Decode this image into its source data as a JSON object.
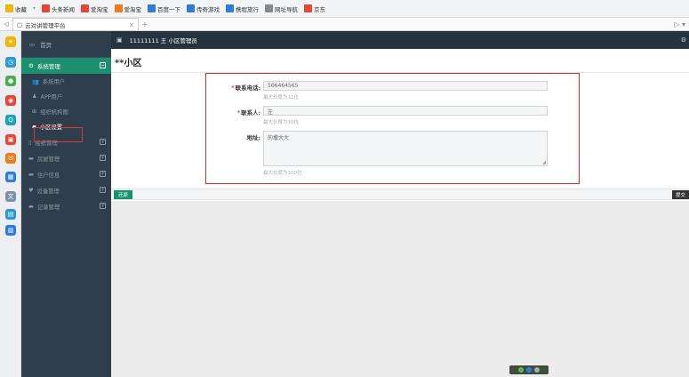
{
  "browser": {
    "bookmarks": [
      {
        "label": "收藏",
        "color": "#f5b400",
        "icon": "star-icon"
      },
      {
        "label": "头条新闻",
        "color": "#e8443a",
        "icon": "news-icon"
      },
      {
        "label": "爱淘宝",
        "color": "#e8443a",
        "icon": "taobao-icon"
      },
      {
        "label": "爱淘宝",
        "color": "#f07b1c",
        "icon": "taobao-icon"
      },
      {
        "label": "百度一下",
        "color": "#2e7ce0",
        "icon": "baidu-icon"
      },
      {
        "label": "传奇游戏",
        "color": "#2e7ce0",
        "icon": "game-icon"
      },
      {
        "label": "携程旅行",
        "color": "#2e7ce0",
        "icon": "ctrip-icon"
      },
      {
        "label": "网址导航",
        "color": "#888888",
        "icon": "page-icon"
      },
      {
        "label": "京东",
        "color": "#e8443a",
        "icon": "jd-icon"
      }
    ],
    "tab_label": "云对讲管理平台",
    "tab_close": "×",
    "tab_new": "+",
    "nav_back": "◁",
    "right_controls": "▷ ▾"
  },
  "side_strip": [
    {
      "icon": "favorites-icon",
      "color": "#f5b400",
      "glyph": "★"
    },
    {
      "icon": "history-icon",
      "color": "#2e9ad0",
      "glyph": "◷"
    },
    {
      "icon": "chat-icon",
      "color": "#4cae4c",
      "glyph": "●"
    },
    {
      "icon": "weibo-icon",
      "color": "#e8443a",
      "glyph": "◉"
    },
    {
      "icon": "search-icon",
      "color": "#19a3b5",
      "glyph": "Q"
    },
    {
      "icon": "game-icon",
      "color": "#e8443a",
      "glyph": "▣"
    },
    {
      "icon": "mail-icon",
      "color": "#f07b1c",
      "glyph": "✉"
    },
    {
      "icon": "calc-icon",
      "color": "#2e7ce0",
      "glyph": "▦"
    },
    {
      "icon": "translate-icon",
      "color": "#7b8fa5",
      "glyph": "文"
    },
    {
      "icon": "note-icon",
      "color": "#2e9ad0",
      "glyph": "▤"
    },
    {
      "icon": "save-icon",
      "color": "#2e7ce0",
      "glyph": "▥"
    }
  ],
  "sidebar": {
    "home": "首页",
    "section": "系统管理",
    "sub_items": [
      "系统用户",
      "APP用户",
      "组织机构图",
      "小区设置"
    ],
    "active_sub": 3,
    "items": [
      "楼栋管理",
      "房屋管理",
      "住户信息",
      "设备管理",
      "记录管理"
    ]
  },
  "topbar": {
    "user": "11111111 王 小区管理员"
  },
  "page": {
    "title": "**小区"
  },
  "form": {
    "phone": {
      "label": "联系电话:",
      "value": "566464565",
      "hint": "最大长度为11位"
    },
    "contact": {
      "label": "联系人:",
      "value": "左",
      "hint": "最大长度为10位"
    },
    "address": {
      "label": "地址:",
      "value": "的撒大大",
      "hint": "最大长度为100位"
    },
    "required_mark": "*"
  },
  "actions": {
    "back": "还原",
    "submit": "提交"
  },
  "colors": {
    "sidebar_bg": "#2f3e4c",
    "accent": "#1c8f6e",
    "highlight": "#d83a3a"
  }
}
